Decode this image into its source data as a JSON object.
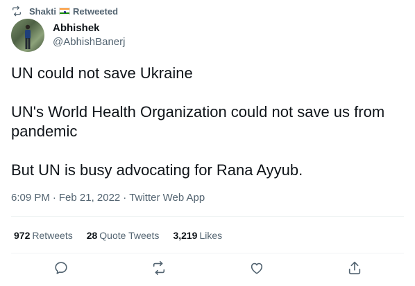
{
  "retweet_context": {
    "user": "Shakti",
    "label": "Retweeted",
    "icon": "retweet-icon",
    "flag_colors": {
      "saffron": "#FF9933",
      "white": "#FFFFFF",
      "green": "#138808",
      "wheel": "#000080"
    }
  },
  "author": {
    "name": "Abhishek",
    "handle": "@AbhishBanerj"
  },
  "tweet": {
    "paragraphs": [
      "UN could not save Ukraine",
      "UN's World Health Organization could not save us from pandemic",
      "But UN is busy advocating for Rana Ayyub."
    ]
  },
  "meta": {
    "time": "6:09 PM",
    "separator": "·",
    "date": "Feb 21, 2022",
    "source": "Twitter Web App"
  },
  "stats": {
    "retweets_count": "972",
    "retweets_label": "Retweets",
    "quote_count": "28",
    "quote_label": "Quote Tweets",
    "likes_count": "3,219",
    "likes_label": "Likes"
  },
  "actions": {
    "icons": [
      "reply-icon",
      "retweet-icon",
      "like-icon",
      "share-icon"
    ]
  },
  "colors": {
    "primary_text": "#0f1419",
    "secondary_text": "#536471",
    "divider": "#eff3f4"
  }
}
